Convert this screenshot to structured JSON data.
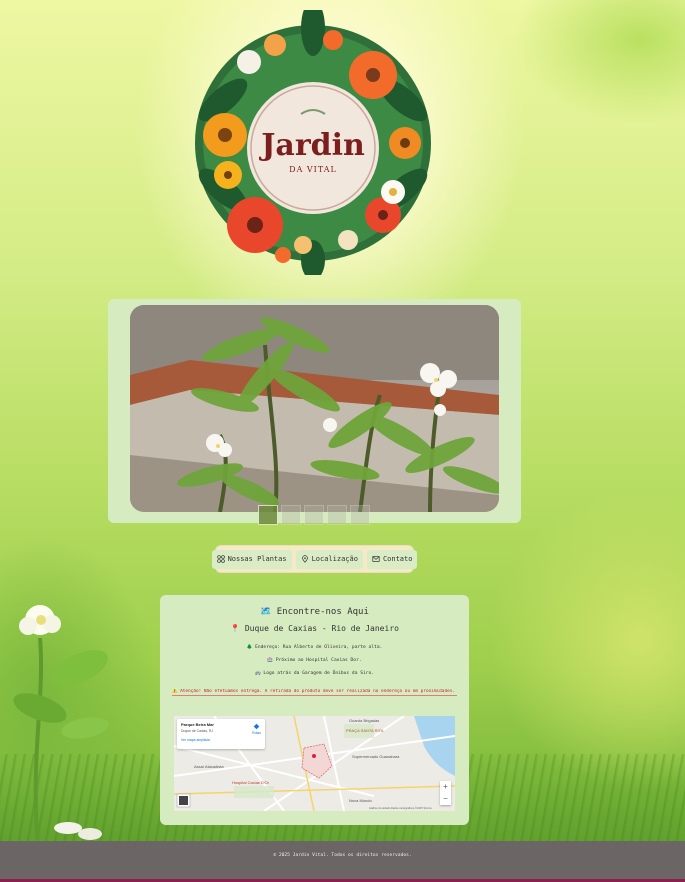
{
  "logo": {
    "title": "Jardin",
    "subtitle": "DA VITAL"
  },
  "gallery": {
    "thumbnail_count": 5
  },
  "nav": {
    "items": [
      {
        "label": "Nossas Plantas",
        "icon": "grid-icon"
      },
      {
        "label": "Localização",
        "icon": "pin-icon"
      },
      {
        "label": "Contato",
        "icon": "mail-icon"
      }
    ]
  },
  "location": {
    "heading": "🗺️ Encontre-nos Aqui",
    "city": "📍 Duque de Caxias - Rio de Janeiro",
    "address": "🌲 Endereço: Rua Alberto de Oliveira, parte alta.",
    "near": "🏥 Próximo ao Hospital Caxias Dor.",
    "behind": "🚌 Logo atrás da Garagem de Ônibus da Siro.",
    "warning": "⚠️ Atenção! Não efetuamos entrega. A retirada do produto deve ser realizada no endereço ou em proximidades. Obrigado."
  },
  "map": {
    "place_name": "Parque Beira Mar",
    "place_sub": "Duque de Caxias, RJ",
    "enlarge_link": "Ver mapa ampliado",
    "route_label": "Rotas",
    "labels": [
      "Guarda Brigadas",
      "PRAÇA SANTA RITA",
      "Supermercado Guanabara",
      "Hospital Caxias D'Or",
      "Assaí Atacadista",
      "Nova Mundo"
    ],
    "zoom_in": "+",
    "zoom_out": "−",
    "footer_text": "Atalhos do teclado  Dados cartográficos ©2025  Termos"
  },
  "footer": {
    "text": "© 2025 Jardin Vital. Todos os direitos reservados."
  },
  "colors": {
    "panel": "#d7ebc1",
    "nav_bg": "#f4eac8",
    "warning": "#c0262d",
    "footer": "#6b6565"
  }
}
